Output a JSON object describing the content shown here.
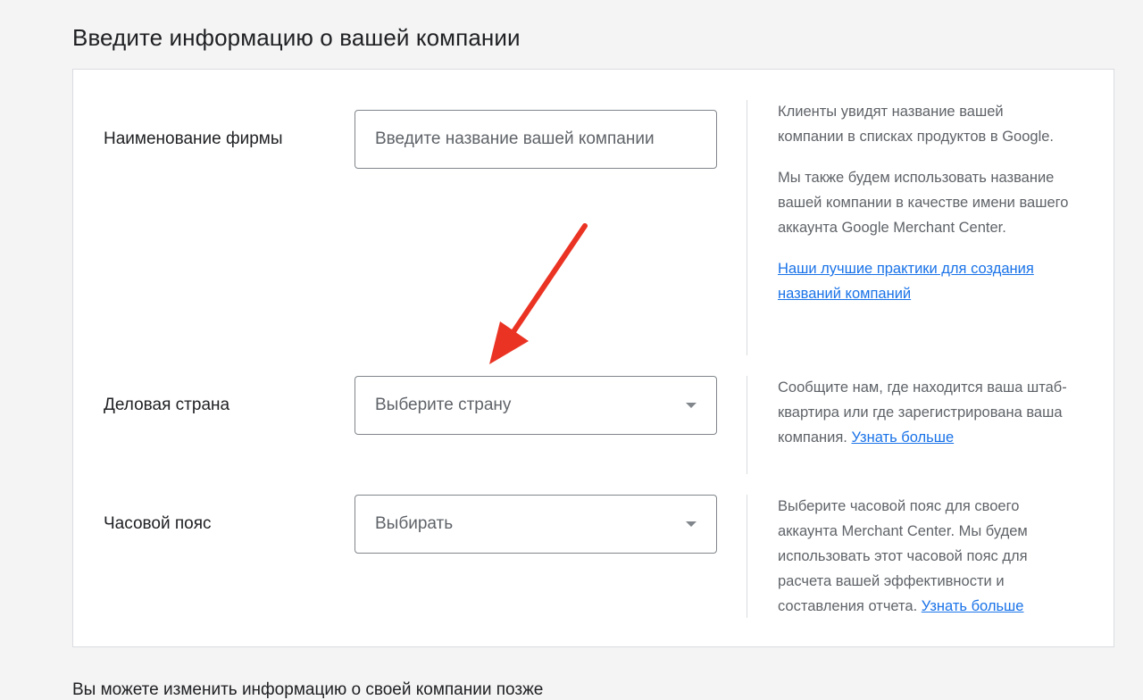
{
  "page": {
    "title": "Введите информацию о вашей компании",
    "footer_text": "Вы можете изменить информацию о своей компании позже"
  },
  "business_name": {
    "label": "Наименование фирмы",
    "placeholder": "Введите название вашей компании",
    "value": "",
    "help_paragraph_1": "Клиенты увидят название вашей компании в списках продуктов в Google.",
    "help_paragraph_2": "Мы также будем использовать название вашей компании в качестве имени вашего аккаунта Google Merchant Center.",
    "help_link": "Наши лучшие практики для создания названий компаний"
  },
  "business_country": {
    "label": "Деловая страна",
    "selected": "Выберите страну",
    "help_text": "Сообщите нам, где находится ваша штаб-квартира или где зарегистрирована ваша компания.",
    "help_link": "Узнать больше"
  },
  "time_zone": {
    "label": "Часовой пояс",
    "selected": "Выбирать",
    "help_text": "Выберите часовой пояс для своего аккаунта Merchant Center. Мы будем использовать этот часовой пояс для расчета вашей эффективности и составления отчета.",
    "help_link": "Узнать больше"
  },
  "annotation": {
    "icon": "red-arrow",
    "color": "#ea3323"
  },
  "colors": {
    "link": "#1a73e8",
    "background": "#f4f4f4",
    "card": "#ffffff"
  }
}
